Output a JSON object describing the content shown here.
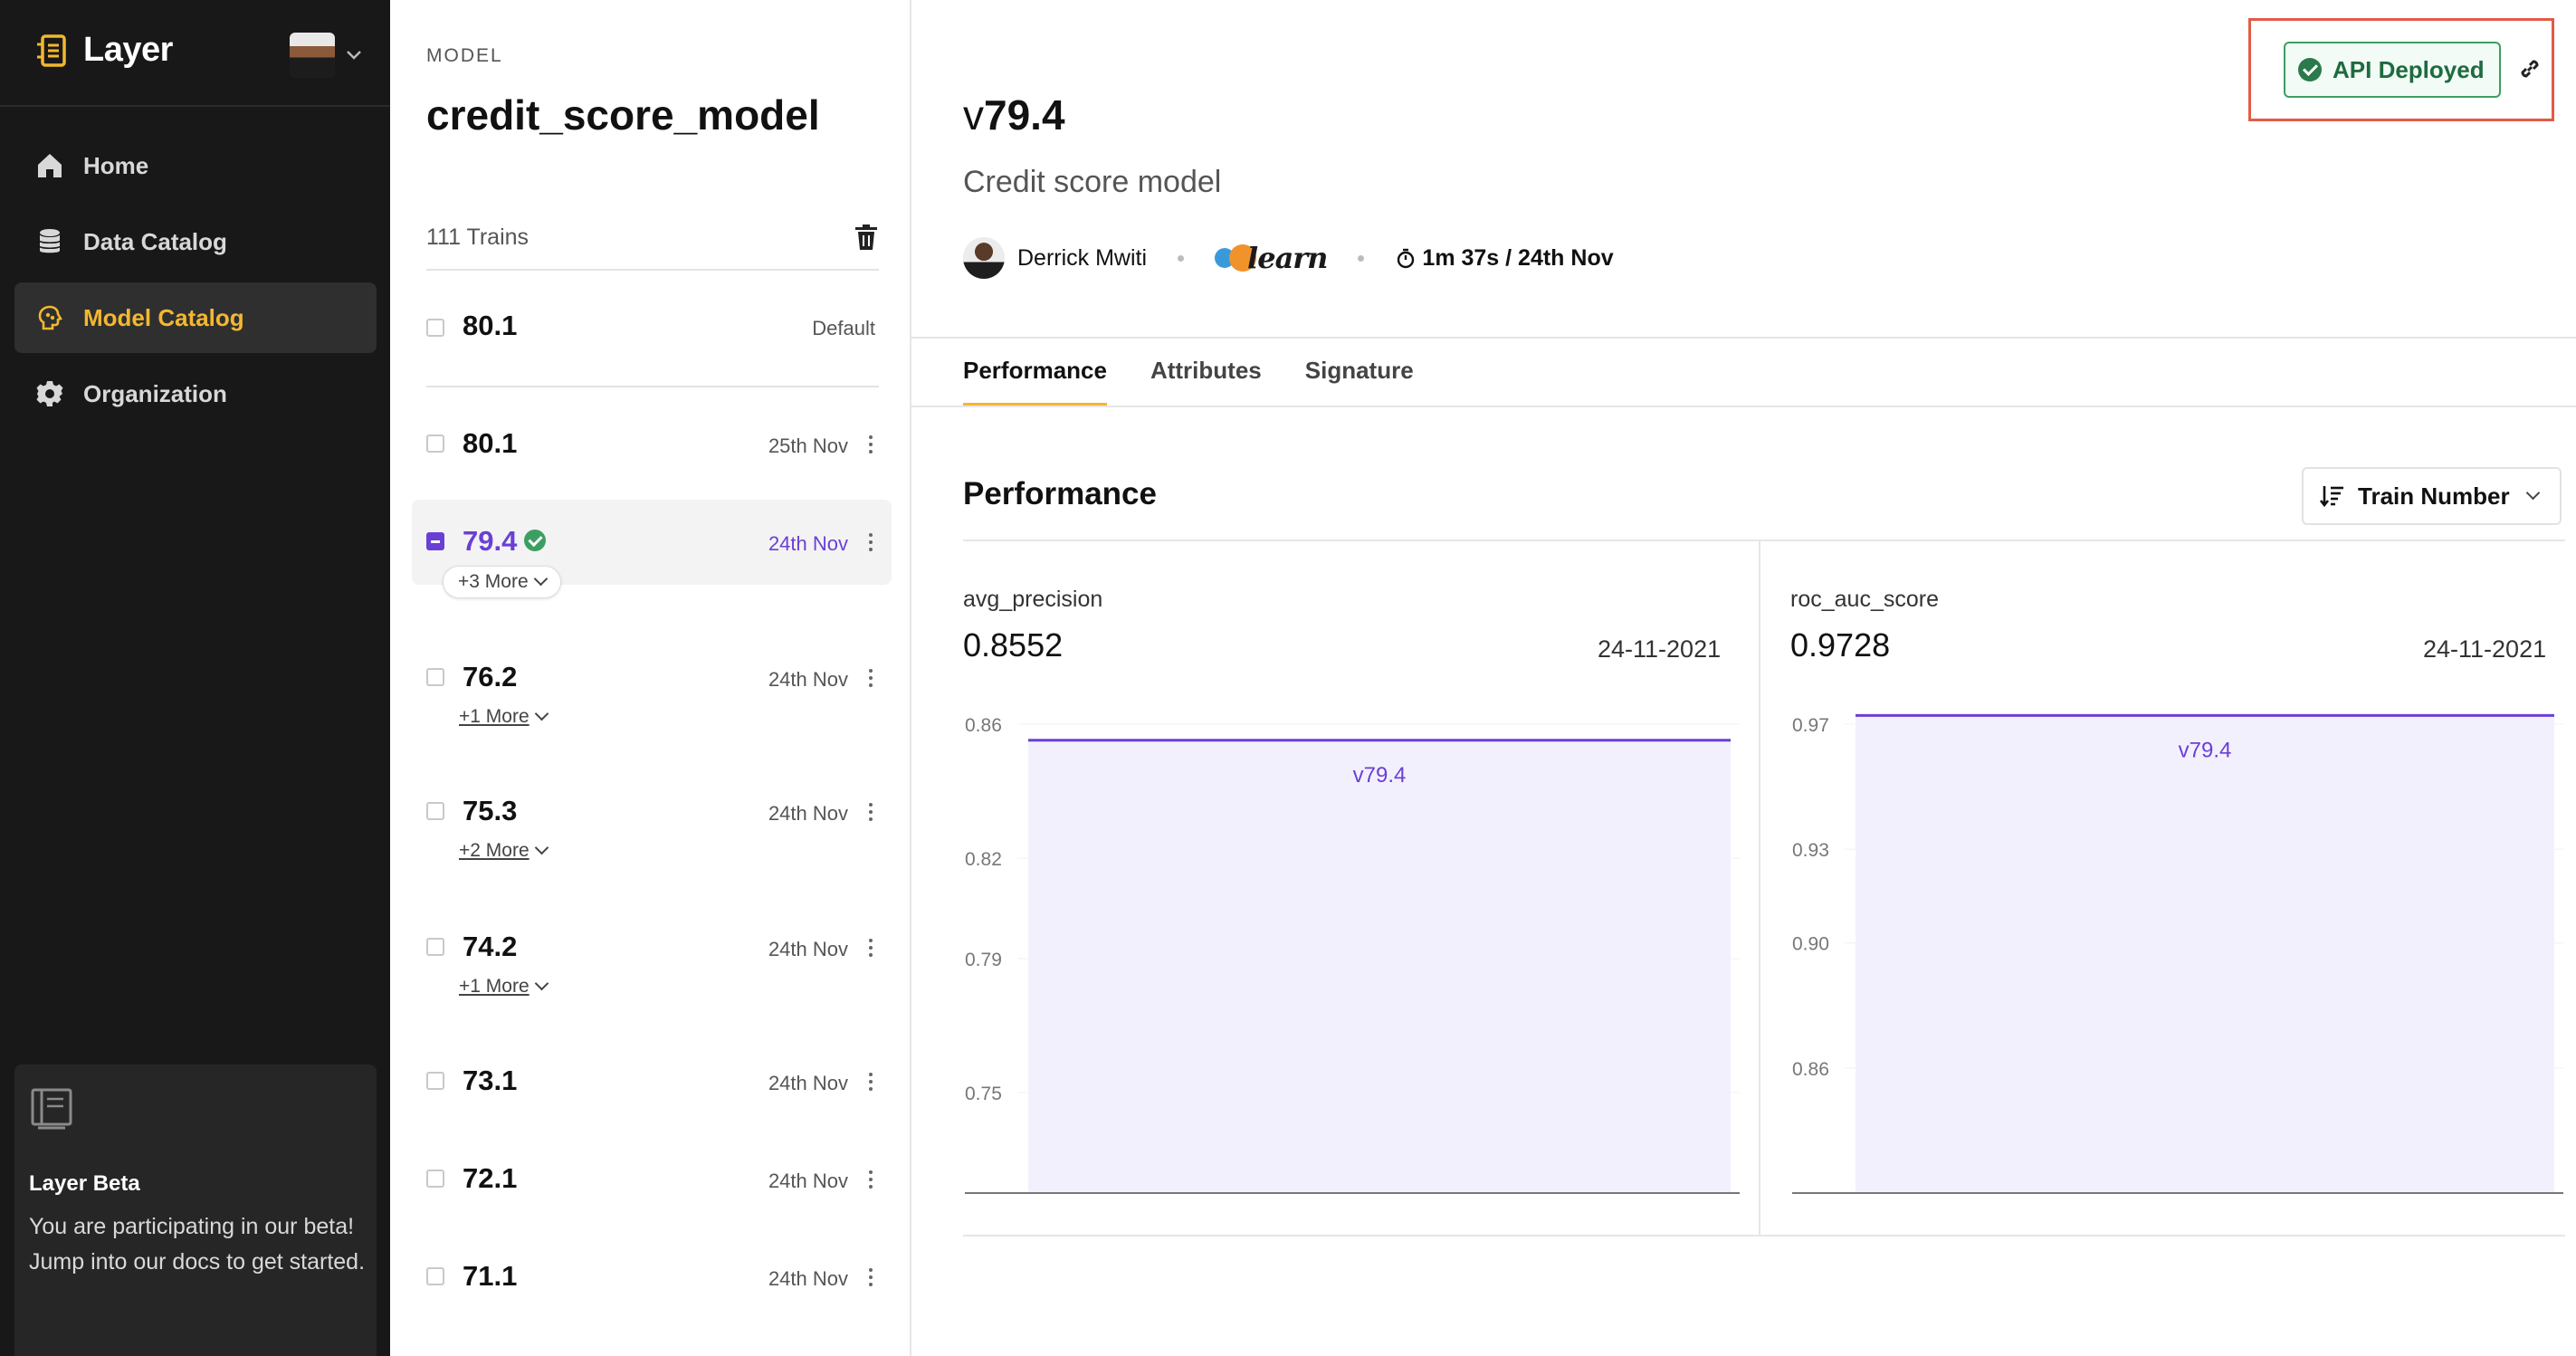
{
  "app": {
    "brand_name": "Layer"
  },
  "sidebar": {
    "items": [
      {
        "label": "Home",
        "icon": "home-icon",
        "active": false
      },
      {
        "label": "Data Catalog",
        "icon": "database-icon",
        "active": false
      },
      {
        "label": "Model Catalog",
        "icon": "brain-icon",
        "active": true
      },
      {
        "label": "Organization",
        "icon": "gear-icon",
        "active": false
      }
    ],
    "beta": {
      "title": "Layer Beta",
      "text": "You are participating in our beta! Jump into our docs to get started."
    }
  },
  "trains_panel": {
    "section_label": "MODEL",
    "model_name": "credit_score_model",
    "count_label": "111 Trains",
    "default_row": {
      "version": "80.1",
      "tag": "Default"
    },
    "rows": [
      {
        "version": "80.1",
        "date": "25th Nov",
        "more": ""
      },
      {
        "version": "79.4",
        "date": "24th Nov",
        "more": "+3 More",
        "selected": true,
        "deployed": true
      },
      {
        "version": "76.2",
        "date": "24th Nov",
        "more": "+1 More"
      },
      {
        "version": "75.3",
        "date": "24th Nov",
        "more": "+2 More"
      },
      {
        "version": "74.2",
        "date": "24th Nov",
        "more": "+1 More"
      },
      {
        "version": "73.1",
        "date": "24th Nov",
        "more": ""
      },
      {
        "version": "72.1",
        "date": "24th Nov",
        "more": ""
      },
      {
        "version": "71.1",
        "date": "24th Nov",
        "more": ""
      }
    ]
  },
  "main": {
    "version_prefix": "v",
    "version_number": "79.4",
    "description": "Credit score model",
    "owner": "Derrick Mwiti",
    "framework_logo_text": "learn",
    "framework_logo_small": "scikit",
    "duration": "1m 37s / 24th Nov",
    "deploy_status": "API Deployed",
    "tabs": [
      "Performance",
      "Attributes",
      "Signature"
    ],
    "section_title": "Performance",
    "sort_label": "Train Number",
    "colors": {
      "accent": "#f3b730",
      "series": "#6a3fd6",
      "deployed": "#3d9e63",
      "highlight": "#e25b46"
    }
  },
  "chart_data": [
    {
      "type": "bar",
      "metric": "avg_precision",
      "value_label": "0.8552",
      "date": "24-11-2021",
      "categories": [
        "v79.4"
      ],
      "values": [
        0.8552
      ],
      "ylim": [
        0.72,
        0.86
      ],
      "yticks": [
        "0.86",
        "0.82",
        "0.79",
        "0.75"
      ],
      "ytick_values": [
        0.86,
        0.82,
        0.79,
        0.75
      ]
    },
    {
      "type": "bar",
      "metric": "roc_auc_score",
      "value_label": "0.9728",
      "date": "24-11-2021",
      "categories": [
        "v79.4"
      ],
      "values": [
        0.9728
      ],
      "ylim": [
        0.82,
        0.97
      ],
      "yticks": [
        "0.97",
        "0.93",
        "0.90",
        "0.86"
      ],
      "ytick_values": [
        0.97,
        0.93,
        0.9,
        0.86
      ]
    }
  ]
}
